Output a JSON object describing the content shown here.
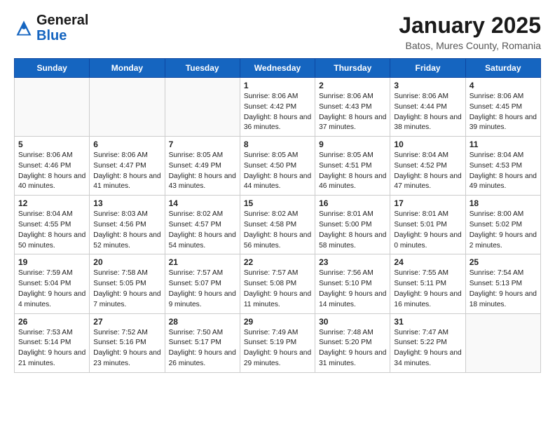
{
  "header": {
    "logo_general": "General",
    "logo_blue": "Blue",
    "title": "January 2025",
    "subtitle": "Batos, Mures County, Romania"
  },
  "weekdays": [
    "Sunday",
    "Monday",
    "Tuesday",
    "Wednesday",
    "Thursday",
    "Friday",
    "Saturday"
  ],
  "weeks": [
    [
      {
        "day": "",
        "info": ""
      },
      {
        "day": "",
        "info": ""
      },
      {
        "day": "",
        "info": ""
      },
      {
        "day": "1",
        "info": "Sunrise: 8:06 AM\nSunset: 4:42 PM\nDaylight: 8 hours and 36 minutes."
      },
      {
        "day": "2",
        "info": "Sunrise: 8:06 AM\nSunset: 4:43 PM\nDaylight: 8 hours and 37 minutes."
      },
      {
        "day": "3",
        "info": "Sunrise: 8:06 AM\nSunset: 4:44 PM\nDaylight: 8 hours and 38 minutes."
      },
      {
        "day": "4",
        "info": "Sunrise: 8:06 AM\nSunset: 4:45 PM\nDaylight: 8 hours and 39 minutes."
      }
    ],
    [
      {
        "day": "5",
        "info": "Sunrise: 8:06 AM\nSunset: 4:46 PM\nDaylight: 8 hours and 40 minutes."
      },
      {
        "day": "6",
        "info": "Sunrise: 8:06 AM\nSunset: 4:47 PM\nDaylight: 8 hours and 41 minutes."
      },
      {
        "day": "7",
        "info": "Sunrise: 8:05 AM\nSunset: 4:49 PM\nDaylight: 8 hours and 43 minutes."
      },
      {
        "day": "8",
        "info": "Sunrise: 8:05 AM\nSunset: 4:50 PM\nDaylight: 8 hours and 44 minutes."
      },
      {
        "day": "9",
        "info": "Sunrise: 8:05 AM\nSunset: 4:51 PM\nDaylight: 8 hours and 46 minutes."
      },
      {
        "day": "10",
        "info": "Sunrise: 8:04 AM\nSunset: 4:52 PM\nDaylight: 8 hours and 47 minutes."
      },
      {
        "day": "11",
        "info": "Sunrise: 8:04 AM\nSunset: 4:53 PM\nDaylight: 8 hours and 49 minutes."
      }
    ],
    [
      {
        "day": "12",
        "info": "Sunrise: 8:04 AM\nSunset: 4:55 PM\nDaylight: 8 hours and 50 minutes."
      },
      {
        "day": "13",
        "info": "Sunrise: 8:03 AM\nSunset: 4:56 PM\nDaylight: 8 hours and 52 minutes."
      },
      {
        "day": "14",
        "info": "Sunrise: 8:02 AM\nSunset: 4:57 PM\nDaylight: 8 hours and 54 minutes."
      },
      {
        "day": "15",
        "info": "Sunrise: 8:02 AM\nSunset: 4:58 PM\nDaylight: 8 hours and 56 minutes."
      },
      {
        "day": "16",
        "info": "Sunrise: 8:01 AM\nSunset: 5:00 PM\nDaylight: 8 hours and 58 minutes."
      },
      {
        "day": "17",
        "info": "Sunrise: 8:01 AM\nSunset: 5:01 PM\nDaylight: 9 hours and 0 minutes."
      },
      {
        "day": "18",
        "info": "Sunrise: 8:00 AM\nSunset: 5:02 PM\nDaylight: 9 hours and 2 minutes."
      }
    ],
    [
      {
        "day": "19",
        "info": "Sunrise: 7:59 AM\nSunset: 5:04 PM\nDaylight: 9 hours and 4 minutes."
      },
      {
        "day": "20",
        "info": "Sunrise: 7:58 AM\nSunset: 5:05 PM\nDaylight: 9 hours and 7 minutes."
      },
      {
        "day": "21",
        "info": "Sunrise: 7:57 AM\nSunset: 5:07 PM\nDaylight: 9 hours and 9 minutes."
      },
      {
        "day": "22",
        "info": "Sunrise: 7:57 AM\nSunset: 5:08 PM\nDaylight: 9 hours and 11 minutes."
      },
      {
        "day": "23",
        "info": "Sunrise: 7:56 AM\nSunset: 5:10 PM\nDaylight: 9 hours and 14 minutes."
      },
      {
        "day": "24",
        "info": "Sunrise: 7:55 AM\nSunset: 5:11 PM\nDaylight: 9 hours and 16 minutes."
      },
      {
        "day": "25",
        "info": "Sunrise: 7:54 AM\nSunset: 5:13 PM\nDaylight: 9 hours and 18 minutes."
      }
    ],
    [
      {
        "day": "26",
        "info": "Sunrise: 7:53 AM\nSunset: 5:14 PM\nDaylight: 9 hours and 21 minutes."
      },
      {
        "day": "27",
        "info": "Sunrise: 7:52 AM\nSunset: 5:16 PM\nDaylight: 9 hours and 23 minutes."
      },
      {
        "day": "28",
        "info": "Sunrise: 7:50 AM\nSunset: 5:17 PM\nDaylight: 9 hours and 26 minutes."
      },
      {
        "day": "29",
        "info": "Sunrise: 7:49 AM\nSunset: 5:19 PM\nDaylight: 9 hours and 29 minutes."
      },
      {
        "day": "30",
        "info": "Sunrise: 7:48 AM\nSunset: 5:20 PM\nDaylight: 9 hours and 31 minutes."
      },
      {
        "day": "31",
        "info": "Sunrise: 7:47 AM\nSunset: 5:22 PM\nDaylight: 9 hours and 34 minutes."
      },
      {
        "day": "",
        "info": ""
      }
    ]
  ]
}
